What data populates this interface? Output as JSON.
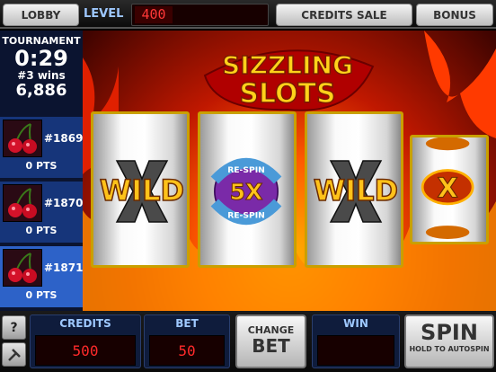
{
  "topbar": {
    "lobby_label": "LOBBY",
    "level_label": "LEVEL",
    "level_value": "400",
    "credits_sale_label": "CREDITS SALE",
    "bonus_label": "BONUS"
  },
  "tournament": {
    "title": "TOURNAMENT",
    "timer": "0:29",
    "wins": "#3 wins",
    "score": "6,886"
  },
  "players": [
    {
      "rank": "#1869",
      "points": "0 PTS",
      "icon": "cherries-icon"
    },
    {
      "rank": "#1870",
      "points": "0 PTS",
      "icon": "cherries-icon"
    },
    {
      "rank": "#1871",
      "points": "0 PTS",
      "icon": "cherries-icon"
    }
  ],
  "logo": {
    "line1": "SIZZLING",
    "line2": "SLOTS"
  },
  "reels": {
    "reel1": "WILD",
    "reel2_top": "RE-SPIN",
    "reel2_mid": "5X",
    "reel2_bottom": "RE-SPIN",
    "reel3": "WILD",
    "reel4": "X"
  },
  "bottom": {
    "help_label": "?",
    "settings_icon": "tools-icon",
    "credits_label": "CREDITS",
    "credits_value": "500",
    "bet_label": "BET",
    "bet_value": "50",
    "change_label": "CHANGE",
    "change_bet_label": "BET",
    "win_label": "WIN",
    "win_value": "",
    "spin_label": "SPIN",
    "autospin_label": "HOLD TO AUTOSPIN"
  },
  "colors": {
    "panel_blue": "#0f1c3c",
    "active_blue": "#2d62c8",
    "digital_red": "#ff2a2a",
    "reel_gold": "#c9a000"
  }
}
